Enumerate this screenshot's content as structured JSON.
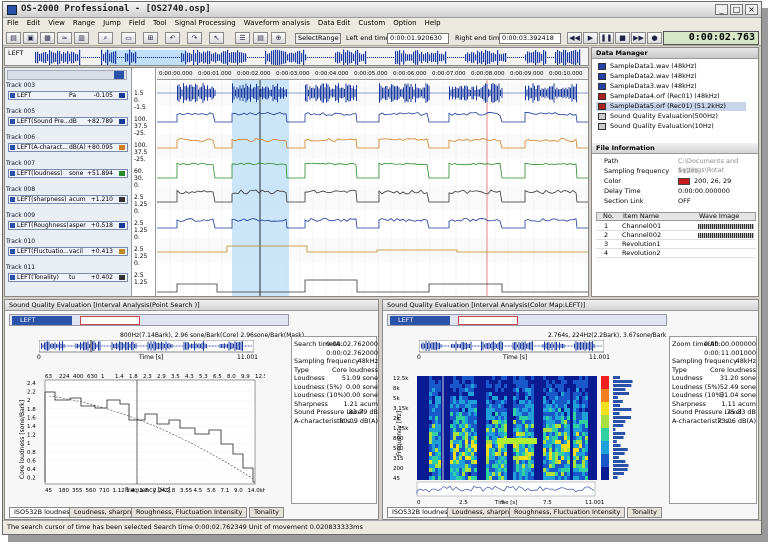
{
  "window": {
    "title": "OS-2000 Professional - [OS2740.osp]"
  },
  "menu": [
    "File",
    "Edit",
    "View",
    "Range",
    "Jump",
    "Field",
    "Tool",
    "Signal Processing",
    "Waveform analysis",
    "Data Edit",
    "Custom",
    "Option",
    "Help"
  ],
  "toolbar": {
    "select_range": "SelectRange",
    "left_end_label": "Left end time",
    "left_end_value": "0:00:01.920630",
    "right_end_label": "Right end time",
    "right_end_value": "0:00:03.392418",
    "current_time": "0:00:02.763"
  },
  "overview": {
    "label": "LEFT"
  },
  "timeline": {
    "ticks": [
      "0:00:00.000",
      "0:00:01.000",
      "0:00:02.000",
      "0:00:03.000",
      "0:00:04.000",
      "0:00:05.000",
      "0:00:06.000",
      "0:00:07.000",
      "0:00:08.000",
      "0:00:09.000",
      "0:00:10.000",
      "0:00:11.000"
    ]
  },
  "tracks": [
    {
      "head": "Track 003",
      "name": "LEFT",
      "unit": "Pa",
      "value": "-0.105",
      "color": "#1a3a9a",
      "axis": [
        "1.5",
        "0.",
        "-1.5"
      ]
    },
    {
      "head": "Track 005",
      "name": "LEFT(Sound Pre...",
      "unit": "dB",
      "value": "+82.789",
      "color": "#1a3a9a",
      "axis": [
        "100.",
        "37.5",
        "-25."
      ]
    },
    {
      "head": "Track 006",
      "name": "LEFT(A-charact...",
      "unit": "dB(A)",
      "value": "+80.095",
      "color": "#d08020",
      "axis": [
        "100.",
        "37.5",
        "-25."
      ]
    },
    {
      "head": "Track 007",
      "name": "LEFT(loudness)",
      "unit": "sone",
      "value": "+51.894",
      "color": "#2a8a2a",
      "axis": [
        "60.",
        "30.",
        "0."
      ]
    },
    {
      "head": "Track 008",
      "name": "LEFT(sharpness)",
      "unit": "acum",
      "value": "+1.210",
      "color": "#333333",
      "axis": [
        "2.5",
        "1.25",
        "0."
      ]
    },
    {
      "head": "Track 009",
      "name": "LEFT(Roughness)",
      "unit": "asper",
      "value": "+0.518",
      "color": "#1a3a9a",
      "axis": [
        "2.5",
        "1.25",
        "0."
      ]
    },
    {
      "head": "Track 010",
      "name": "LEFT(Fluctuatio...",
      "unit": "vacil",
      "value": "+0.413",
      "color": "#c08a20",
      "axis": [
        "2.5",
        "1.25",
        "0."
      ]
    },
    {
      "head": "Track 011",
      "name": "LEFT(Tonality)",
      "unit": "tu",
      "value": "+0.402",
      "color": "#333333",
      "axis": [
        "2.5",
        "1.25"
      ]
    }
  ],
  "data_manager": {
    "title": "Data Manager",
    "items": [
      {
        "label": "SampleData1.wav (48kHz)",
        "color": "#2244aa"
      },
      {
        "label": "SampleData2.wav (48kHz)",
        "color": "#2244aa"
      },
      {
        "label": "SampleData3.wav (48kHz)",
        "color": "#2244aa"
      },
      {
        "label": "SampleData4.orf (Rec01) (48kHz)",
        "color": "#aa2222"
      },
      {
        "label": "SampleData5.orf (Rec01) (51.2kHz)",
        "color": "#aa2222"
      },
      {
        "label": "Sound Quality Evaluation(500Hz)",
        "color": "#cccccc"
      },
      {
        "label": "Sound Quality Evaluation(10Hz)",
        "color": "#cccccc"
      }
    ],
    "selected_index": 4
  },
  "file_info": {
    "title": "File Information",
    "rows": [
      {
        "k": "Path",
        "v": "C:\\Documents and Settings\\Rotat"
      },
      {
        "k": "Sampling frequency",
        "v": "51200"
      },
      {
        "k": "Color",
        "v": "200, 26, 29"
      },
      {
        "k": "Delay Time",
        "v": "0:00:00.000000"
      },
      {
        "k": "Section Link",
        "v": "OFF"
      }
    ],
    "color_swatch": "#c81a1d"
  },
  "channel_table": {
    "headers": [
      "No.",
      "Item Name",
      "Wave Image"
    ],
    "rows": [
      {
        "no": "1",
        "name": "Channel001"
      },
      {
        "no": "2",
        "name": "Channel002"
      },
      {
        "no": "3",
        "name": "Revolution1"
      },
      {
        "no": "4",
        "name": "Revolution2"
      }
    ]
  },
  "left_eval": {
    "title": "Sound Quality Evaluation [Interval Analysis(Point Search )]",
    "tag": "LEFT",
    "peak_label": "800Hz(7.14Bark), 2.96 sone/Bark(Core) 2.96sone/Bark(Mask)",
    "mini_ticks": [
      "0",
      "Time [s]",
      "11.001"
    ],
    "chart_top_ticks": [
      "63",
      "224",
      "400",
      "630",
      "1",
      "1.4",
      "1.8",
      "2.3",
      "2.9",
      "3.5",
      "4.3",
      "5.3",
      "6.5",
      "8.0",
      "9.9",
      "12.5kHz"
    ],
    "y_axis": [
      "2.4",
      "2.2",
      "2",
      "1.8",
      "1.6",
      "1.4",
      "1.2",
      "1",
      "0.8",
      "0.6",
      "0.4",
      "0.2"
    ],
    "ylabel": "Core loudness [sone/Bark]",
    "xlabel": "Frequency [Hz]",
    "x_ticks": [
      "45",
      "180",
      "355",
      "560",
      "710",
      "1.12",
      "1.4",
      "1.8",
      "2.24",
      "2.8",
      "3.55",
      "4.5",
      "5.6",
      "7.1",
      "9.0",
      "14.0kHz"
    ],
    "stats": [
      {
        "k": "Search time(A...",
        "v": "0:00:02.762000"
      },
      {
        "k": "",
        "v": "0:00:02.762000"
      },
      {
        "k": "Sampling frequency",
        "v": "48kHz"
      },
      {
        "k": "Type",
        "v": "Core loudness"
      },
      {
        "k": "Loudness",
        "v": "51.09 sone"
      },
      {
        "k": "Loudness (5%)",
        "v": "0.00 sone"
      },
      {
        "k": "Loudness (10%)",
        "v": "0.00 sone"
      },
      {
        "k": "Sharpness",
        "v": "1.21 acum"
      },
      {
        "k": "Sound Pressure Level",
        "v": "82.79 dB"
      },
      {
        "k": "A-characteristic s...",
        "v": "80.09 dB(A)"
      }
    ],
    "tabs": [
      "ISO532B loudness",
      "Loudness, sharpness",
      "Roughness, Fluctuation Intensity",
      "Tonality"
    ],
    "active_tab": 0
  },
  "right_eval": {
    "title": "Sound Quality Evaluation [Interval Analysis(Color Map:LEFT)]",
    "tag": "LEFT",
    "peak_label": "2.764s, 224Hz(2.2Bark), 3.67sone/Bark",
    "mini_ticks": [
      "0",
      "Time [s]",
      "11.001"
    ],
    "y_axis": [
      "12.5k",
      "8k",
      "5k",
      "3.15k",
      "2k",
      "1.25k",
      "800",
      "500",
      "315",
      "200",
      "45"
    ],
    "ylabel": "Frequency [Hz]",
    "x_ticks": [
      "0",
      "2.5",
      "5",
      "7.5",
      "11.001"
    ],
    "xlabel": "Time [s]",
    "stats": [
      {
        "k": "Zoom time(Ab...",
        "v": "0:00:00.000000"
      },
      {
        "k": "",
        "v": "0:00:11.001000"
      },
      {
        "k": "Sampling frequency",
        "v": "48kHz"
      },
      {
        "k": "Type",
        "v": "Core loudness"
      },
      {
        "k": "Loudness",
        "v": "31.20 sone"
      },
      {
        "k": "Loudness (5%)",
        "v": "52.49 sone"
      },
      {
        "k": "Loudness (10%)",
        "v": "51.04 sone"
      },
      {
        "k": "Sharpness",
        "v": "1.11 acum"
      },
      {
        "k": "Sound Pressure Level",
        "v": "75.33 dB"
      },
      {
        "k": "A-characteristic s...",
        "v": "73.06 dB(A)"
      }
    ],
    "tabs": [
      "ISO532B loudness",
      "Loudness, sharpness",
      "Roughness, Fluctuation Intensity",
      "Tonality"
    ],
    "active_tab": 0
  },
  "status": {
    "text": "The search cursor of time has been selected  Search time 0:00:02.762349 Unit of movement 0.020833333ms"
  },
  "colors": {
    "accent": "#2a52a8",
    "selection": "#bfe0f8",
    "wave": "#1a3aa0"
  }
}
